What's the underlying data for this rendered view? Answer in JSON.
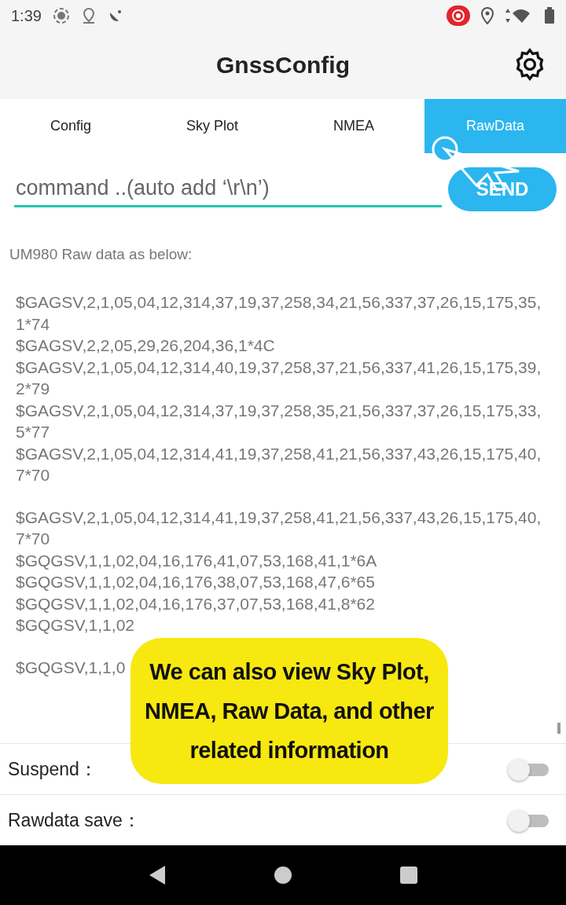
{
  "status_bar": {
    "time": "1:39"
  },
  "app_bar": {
    "title": "GnssConfig"
  },
  "tabs": [
    {
      "label": "Config",
      "selected": false
    },
    {
      "label": "Sky Plot",
      "selected": false
    },
    {
      "label": "NMEA",
      "selected": false
    },
    {
      "label": "RawData",
      "selected": true
    }
  ],
  "command": {
    "placeholder": "command ..(auto add ‘\\r\\n’)",
    "button": "SEND"
  },
  "log": {
    "heading": "UM980 Raw data as below:",
    "blocks": [
      {
        "lines": [
          "$GAGSV,2,1,05,04,12,314,37,19,37,258,34,21,56,337,37,26,15,175,35,",
          "1*74",
          "$GAGSV,2,2,05,29,26,204,36,1*4C",
          "$GAGSV,2,1,05,04,12,314,40,19,37,258,37,21,56,337,41,26,15,175,39,",
          "2*79",
          "$GAGSV,2,1,05,04,12,314,37,19,37,258,35,21,56,337,37,26,15,175,33,",
          "5*77",
          "$GAGSV,2,1,05,04,12,314,41,19,37,258,41,21,56,337,43,26,15,175,40,",
          "7*70"
        ]
      },
      {
        "lines": [
          "$GAGSV,2,1,05,04,12,314,41,19,37,258,41,21,56,337,43,26,15,175,40,",
          "7*70",
          "$GQGSV,1,1,02,04,16,176,41,07,53,168,41,1*6A",
          "$GQGSV,1,1,02,04,16,176,38,07,53,168,47,6*65",
          "$GQGSV,1,1,02,04,16,176,37,07,53,168,41,8*62",
          "$GQGSV,1,1,02"
        ]
      },
      {
        "lines": [
          "$GQGSV,1,1,0"
        ]
      }
    ]
  },
  "callout": {
    "text": "We can also view Sky Plot, NMEA, Raw Data, and other related information"
  },
  "settings": [
    {
      "label": "Suspend：",
      "on": false
    },
    {
      "label": "Rawdata save：",
      "on": false
    }
  ]
}
